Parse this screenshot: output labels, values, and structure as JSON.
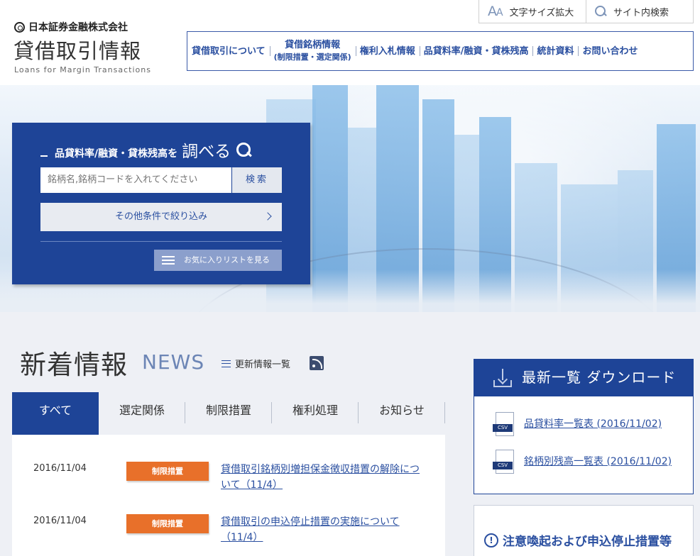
{
  "header": {
    "corp_name": "日本証券金融株式会社",
    "site_title": "貸借取引情報",
    "site_subtitle": "Loans for Margin Transactions",
    "util": {
      "font_size_label": "文字サイズ拡大",
      "font_icon_text": "A",
      "font_icon_small": "A",
      "site_search_label": "サイト内検索"
    },
    "nav": [
      {
        "label": "貸借取引について"
      },
      {
        "label": "貸借銘柄情報",
        "sub": "(制限措置・選定関係)"
      },
      {
        "label": "権利入札情報"
      },
      {
        "label": "品貸料率/融資・貸株残高"
      },
      {
        "label": "統計資料"
      },
      {
        "label": "お問い合わせ"
      }
    ]
  },
  "search": {
    "title_small": "品貸料率/融資・貸株残高を",
    "title_big": "調べる",
    "placeholder": "銘柄名,銘柄コードを入れてください",
    "button": "検索",
    "filter": "その他条件で絞り込み",
    "favorites": "お気に入りリストを見る"
  },
  "news": {
    "heading": "新着情報",
    "heading_en": "NEWS",
    "list_link": "更新情報一覧",
    "tabs": [
      "すべて",
      "選定関係",
      "制限措置",
      "権利処理",
      "お知らせ"
    ],
    "active_tab": 0,
    "items": [
      {
        "date": "2016/11/04",
        "tag": "制限措置",
        "text": "貸借取引銘柄別増担保金徴収措置の解除について（11/4）"
      },
      {
        "date": "2016/11/04",
        "tag": "制限措置",
        "text": "貸借取引の申込停止措置の実施について（11/4）"
      }
    ]
  },
  "download": {
    "title": "最新一覧  ダウンロード",
    "icon_label": "CSV",
    "files": [
      {
        "label": "品貸料率一覧表 (2016/11/02)"
      },
      {
        "label": "銘柄別残高一覧表 (2016/11/02)"
      }
    ]
  },
  "alert": {
    "title": "注意喚起および申込停止措置等",
    "icon_text": "!"
  },
  "colors": {
    "primary": "#1e4497",
    "accent": "#e8702a",
    "link": "#2a4fa0"
  }
}
